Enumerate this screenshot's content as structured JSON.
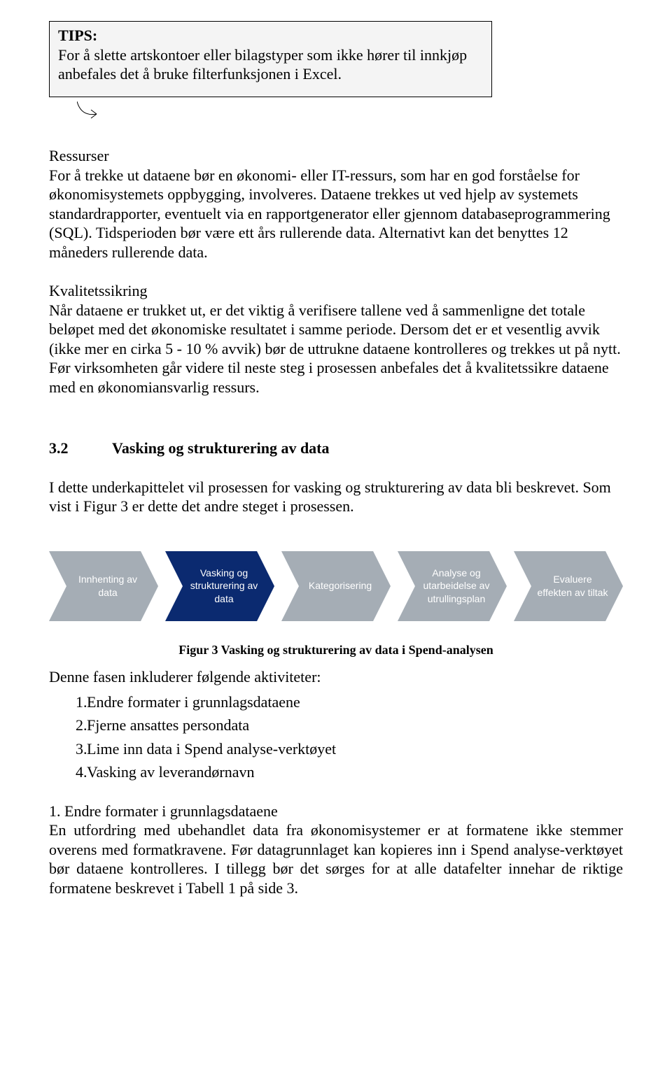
{
  "tips": {
    "title": "TIPS:",
    "body": "For å slette artskontoer eller bilagstyper som ikke hører til innkjøp anbefales det å bruke filterfunksjonen i Excel."
  },
  "ressurser": {
    "title": "Ressurser",
    "body": "For å trekke ut dataene bør en økonomi- eller IT-ressurs, som har en god forståelse for økonomisystemets oppbygging, involveres. Dataene trekkes ut ved hjelp av systemets standardrapporter, eventuelt via en rapportgenerator eller gjennom databaseprogrammering (SQL). Tidsperioden bør være ett års rullerende data. Alternativt kan det benyttes 12 måneders rullerende data."
  },
  "kvalitetssikring": {
    "title": "Kvalitetssikring",
    "body": "Når dataene er trukket ut, er det viktig å verifisere tallene ved å sammenligne det totale beløpet med det økonomiske resultatet i samme periode. Dersom det er et vesentlig avvik (ikke mer en cirka 5 - 10 % avvik) bør de uttrukne dataene kontrolleres og trekkes ut på nytt. Før virksomheten går videre til neste steg i prosessen anbefales det å kvalitetssikre dataene med en økonomiansvarlig ressurs."
  },
  "section": {
    "number": "3.2",
    "title": "Vasking og strukturering av data",
    "intro": "I dette underkapittelet vil prosessen for vasking og strukturering av data bli beskrevet. Som vist i Figur 3 er dette det andre steget i prosessen."
  },
  "chevrons": [
    {
      "label": "Innhenting av data",
      "fill": "#a5adb5"
    },
    {
      "label": "Vasking og strukturering av data",
      "fill": "#0b2a70"
    },
    {
      "label": "Kategorisering",
      "fill": "#a5adb5"
    },
    {
      "label": "Analyse og utarbeidelse av utrullingsplan",
      "fill": "#a5adb5"
    },
    {
      "label": "Evaluere effekten av tiltak",
      "fill": "#a5adb5"
    }
  ],
  "figure": {
    "caption": "Figur 3 Vasking og strukturering av data i Spend-analysen"
  },
  "activities": {
    "lead": "Denne fasen inkluderer følgende aktiviteter:",
    "items": [
      "Endre formater i grunnlagsdataene",
      "Fjerne ansattes persondata",
      "Lime inn data i Spend analyse-verktøyet",
      "Vasking av leverandørnavn"
    ]
  },
  "sub1": {
    "title": "1. Endre formater i grunnlagsdataene",
    "body": "En utfordring med ubehandlet data fra økonomisystemer er at formatene ikke stemmer overens med formatkravene. Før datagrunnlaget kan kopieres inn i Spend analyse-verktøyet bør dataene kontrolleres. I tillegg bør det sørges for at alle datafelter innehar de riktige formatene beskrevet i Tabell 1 på side 3."
  }
}
